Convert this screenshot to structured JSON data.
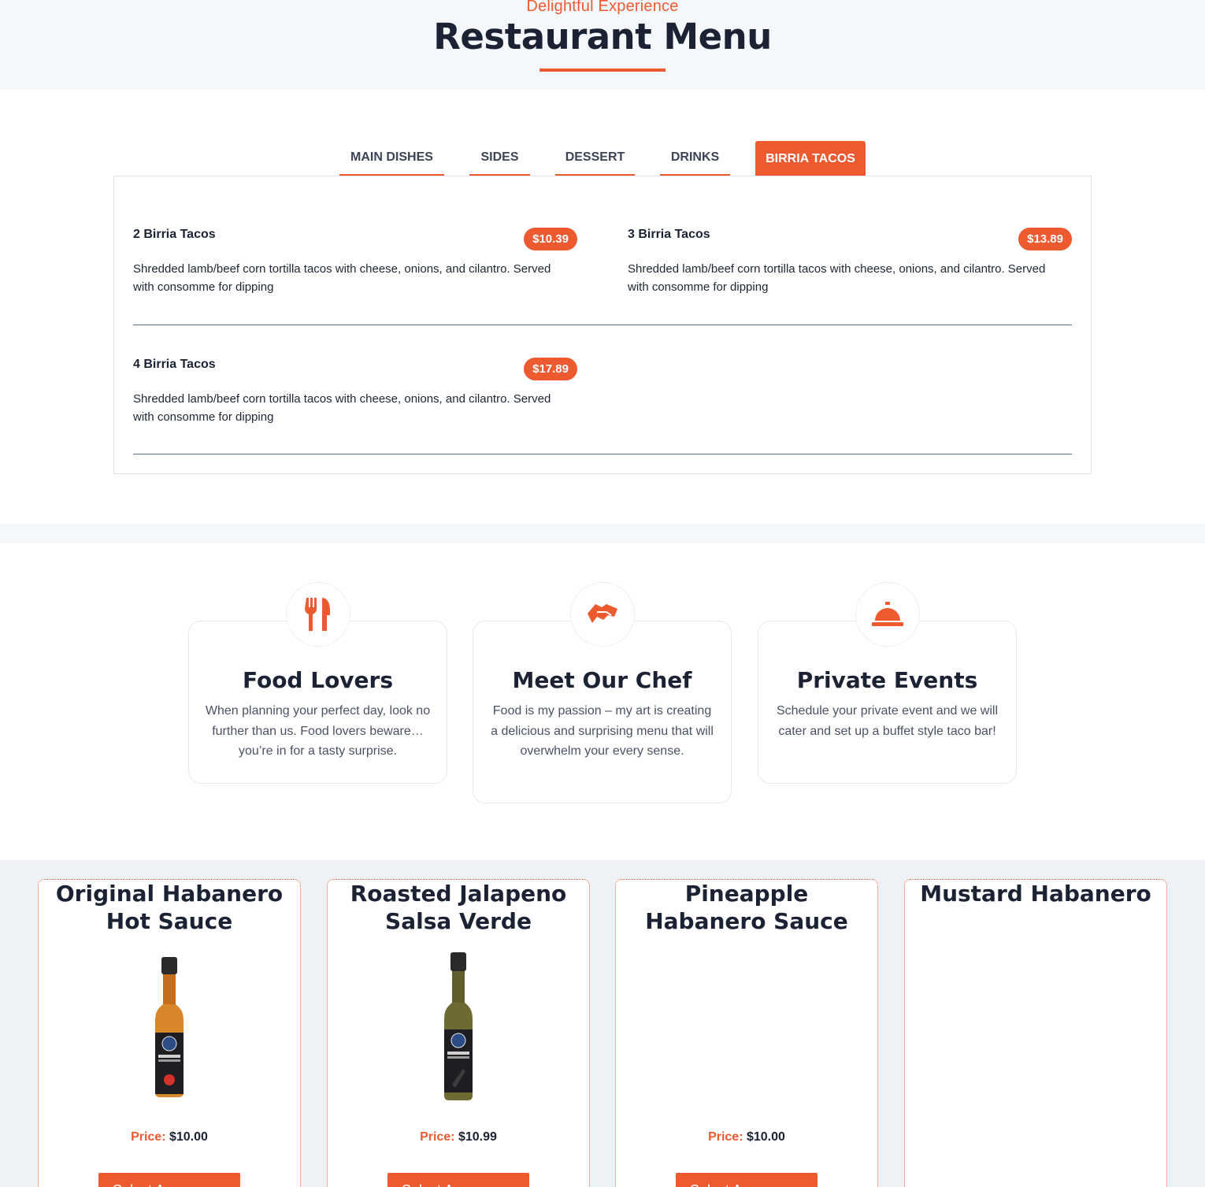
{
  "header": {
    "eyebrow": "Delightful Experience",
    "title": "Restaurant Menu"
  },
  "tabs": [
    {
      "label": "MAIN DISHES",
      "active": false
    },
    {
      "label": "SIDES",
      "active": false
    },
    {
      "label": "DESSERT",
      "active": false
    },
    {
      "label": "DRINKS",
      "active": false
    },
    {
      "label": "BIRRIA TACOS",
      "active": true
    }
  ],
  "menu_items": [
    {
      "name": "2 Birria Tacos",
      "price": "$10.39",
      "description": "Shredded lamb/beef corn tortilla tacos with cheese, onions, and cilantro. Served with consomme for dipping"
    },
    {
      "name": "3 Birria Tacos",
      "price": "$13.89",
      "description": "Shredded lamb/beef corn tortilla tacos with cheese, onions, and cilantro. Served with consomme for dipping"
    },
    {
      "name": "4 Birria Tacos",
      "price": "$17.89",
      "description": "Shredded lamb/beef corn tortilla tacos with cheese, onions, and cilantro. Served with consomme for dipping"
    }
  ],
  "features": [
    {
      "icon": "utensils-icon",
      "title": "Food Lovers",
      "text": "When planning your perfect day, look no further than us. Food lovers beware…you’re in for a tasty surprise."
    },
    {
      "icon": "handshake-icon",
      "title": "Meet Our Chef",
      "text": "Food is my passion – my art is creating a delicious and surprising menu that will overwhelm your every sense."
    },
    {
      "icon": "service-bell-icon",
      "title": "Private Events",
      "text": "Schedule your private event and we will cater and set up a buffet style taco bar!"
    }
  ],
  "products": [
    {
      "title": "Original Habanero Hot Sauce",
      "price_label": "Price:",
      "price": "$10.00",
      "button": "Select A…",
      "has_image": true,
      "bottle_color": "#d8862a"
    },
    {
      "title": "Roasted Jalapeno Salsa Verde",
      "price_label": "Price:",
      "price": "$10.99",
      "button": "Select A…",
      "has_image": true,
      "bottle_color": "#6d6a33"
    },
    {
      "title": "Pineapple Habanero Sauce",
      "price_label": "Price:",
      "price": "$10.00",
      "button": "Select A…",
      "has_image": false
    },
    {
      "title": "Mustard Habanero",
      "has_image": false
    }
  ],
  "colors": {
    "accent": "#ee5a2f",
    "heading": "#1b2233",
    "band": "#f5f8fb"
  }
}
